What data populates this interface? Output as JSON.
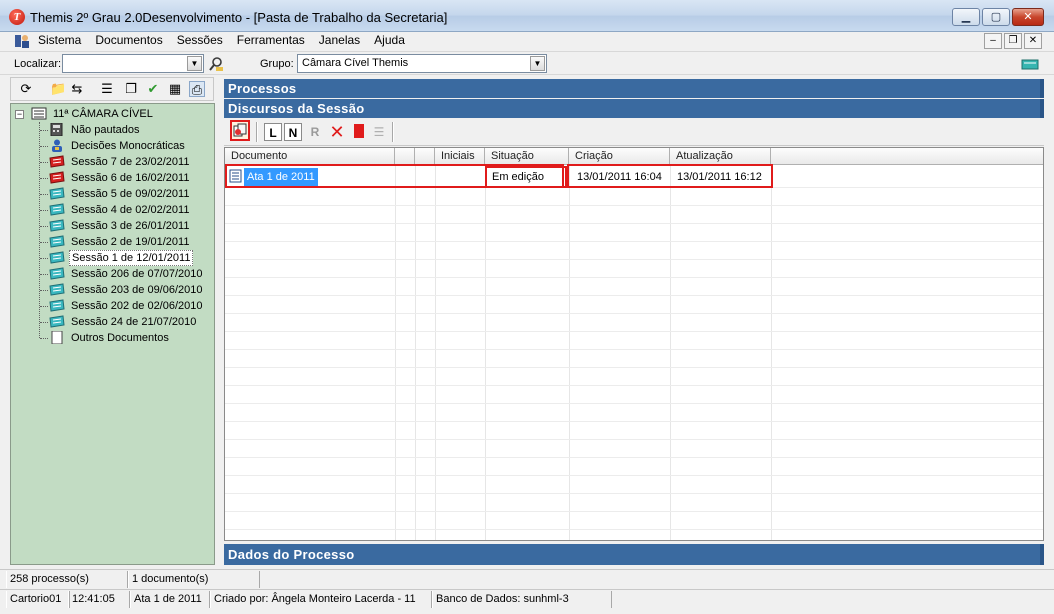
{
  "window": {
    "title": "Themis 2º Grau 2.0Desenvolvimento - [Pasta de Trabalho da Secretaria]",
    "app_icon_letter": "T"
  },
  "menu": {
    "items": [
      "Sistema",
      "Documentos",
      "Sessões",
      "Ferramentas",
      "Janelas",
      "Ajuda"
    ]
  },
  "search": {
    "localizar_label": "Localizar:",
    "localizar_value": "",
    "grupo_label": "Grupo:",
    "grupo_value": "Câmara Cível Themis"
  },
  "tree": {
    "root": "11ª CÂMARA CÍVEL",
    "items": [
      {
        "label": "Não pautados",
        "icon": "calculator-icon"
      },
      {
        "label": "Decisões Monocráticas",
        "icon": "person-icon"
      },
      {
        "label": "Sessão 7 de 23/02/2011",
        "icon": "session-red-icon"
      },
      {
        "label": "Sessão 6 de 16/02/2011",
        "icon": "session-red-icon"
      },
      {
        "label": "Sessão 5 de 09/02/2011",
        "icon": "session-teal-icon"
      },
      {
        "label": "Sessão 4 de 02/02/2011",
        "icon": "session-teal-icon"
      },
      {
        "label": "Sessão 3 de 26/01/2011",
        "icon": "session-teal-icon"
      },
      {
        "label": "Sessão 2 de 19/01/2011",
        "icon": "session-teal-icon"
      },
      {
        "label": "Sessão 1 de 12/01/2011",
        "icon": "session-teal-icon"
      },
      {
        "label": "Sessão 206 de 07/07/2010",
        "icon": "session-teal-icon"
      },
      {
        "label": "Sessão 203 de 09/06/2010",
        "icon": "session-teal-icon"
      },
      {
        "label": "Sessão 202 de 02/06/2010",
        "icon": "session-teal-icon"
      },
      {
        "label": "Sessão 24 de 21/07/2010",
        "icon": "session-teal-icon"
      },
      {
        "label": "Outros Documentos",
        "icon": "document-icon"
      }
    ]
  },
  "panels": {
    "processos": "Processos",
    "discursos": "Discursos da Sessão",
    "dados": "Dados do Processo"
  },
  "doc_toolbar": {
    "btn_L": "L",
    "btn_N": "N",
    "btn_R": "R"
  },
  "grid": {
    "columns": [
      "Documento",
      "",
      "",
      "Iniciais",
      "Situação",
      "Criação",
      "Atualização"
    ],
    "rows": [
      {
        "documento": "Ata 1 de 2011",
        "iniciais": "",
        "situacao": "Em edição",
        "criacao": "13/01/2011 16:04",
        "atualizacao": "13/01/2011 16:12"
      }
    ]
  },
  "status": {
    "processos": "258 processo(s)",
    "documentos": "1 documento(s)",
    "cartorio": "Cartorio01",
    "hora": "12:41:05",
    "documento": "Ata 1 de 2011",
    "criado_por": "Criado por: Ângela Monteiro Lacerda - 11",
    "banco": "Banco de Dados: sunhml-3"
  },
  "colors": {
    "header_blue": "#3a6aa0",
    "tree_bg": "#c2dcc3",
    "highlight_red": "#e01b1b",
    "selection_blue": "#3399ff"
  }
}
